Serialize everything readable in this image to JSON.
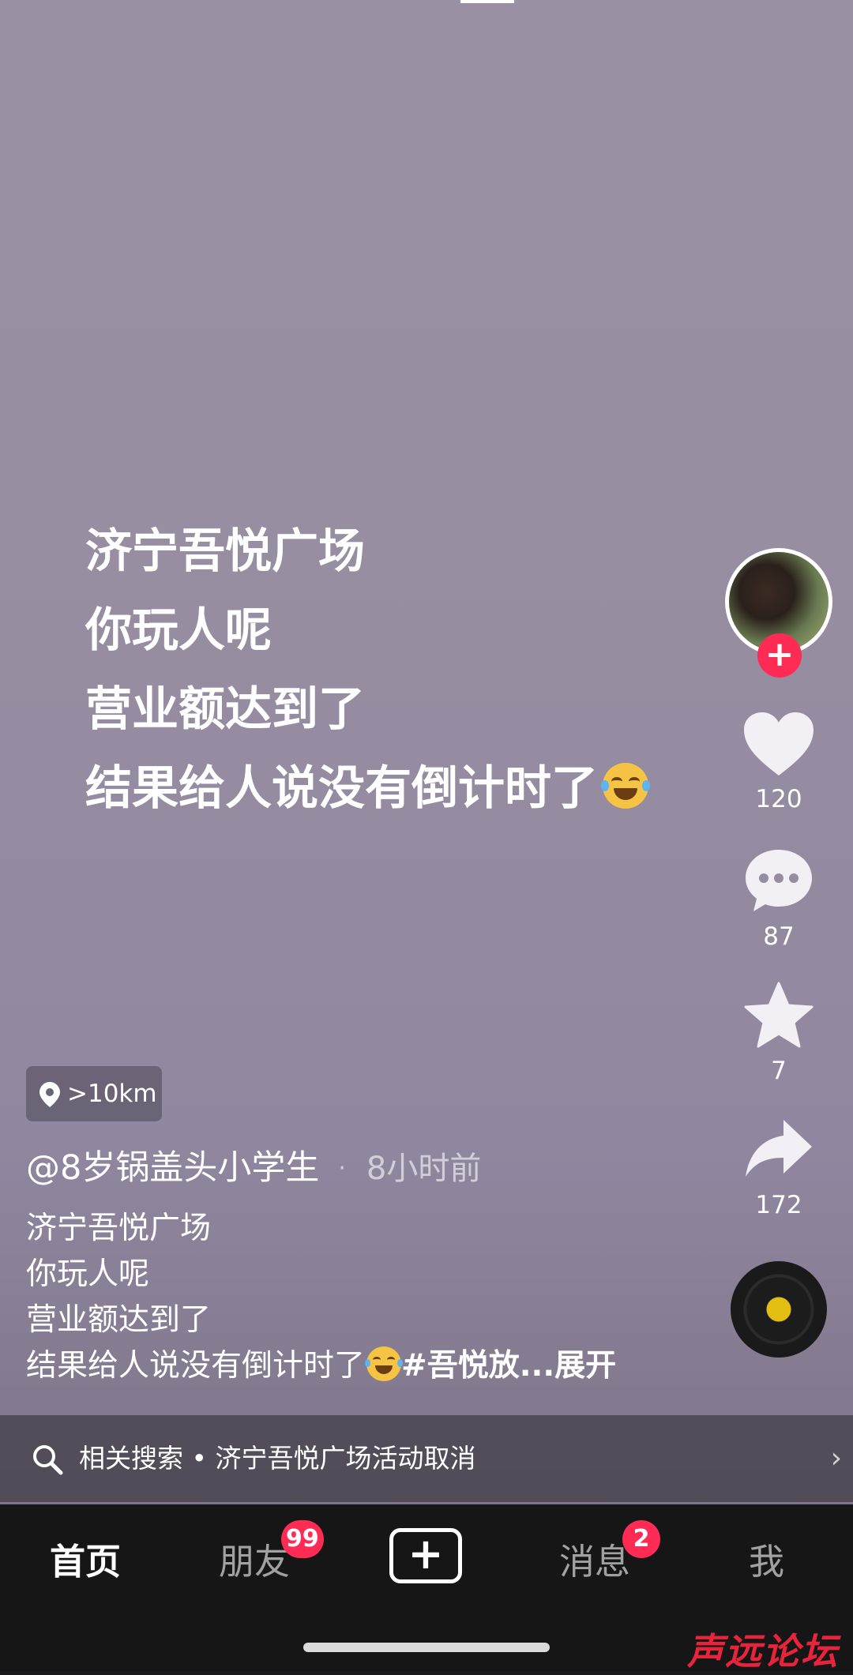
{
  "video": {
    "overlay_lines": [
      "济宁吾悦广场",
      "你玩人呢",
      "营业额达到了",
      "结果给人说没有倒计时了"
    ],
    "overlay_emoji": "laughing-with-tears-emoji"
  },
  "sidebar": {
    "follow_label": "+",
    "like_count": "120",
    "comment_count": "87",
    "favorite_count": "7",
    "share_count": "172"
  },
  "post": {
    "location": ">10km",
    "author": "@8岁锅盖头小学生",
    "separator": "·",
    "time": "8小时前",
    "desc_lines": [
      "济宁吾悦广场",
      "你玩人呢",
      "营业额达到了",
      "结果给人说没有倒计时了"
    ],
    "hashtag": "#吾悦放...",
    "expand_label": "展开"
  },
  "related_search": {
    "text": "相关搜索 • 济宁吾悦广场活动取消",
    "chevron": "›"
  },
  "nav": {
    "home": "首页",
    "friends": "朋友",
    "friends_badge": "99",
    "create": "+",
    "messages": "消息",
    "messages_badge": "2",
    "me": "我"
  },
  "watermark": "声远论坛",
  "colors": {
    "accent": "#fe2c55",
    "video_bg": "#978da1",
    "nav_bg": "#161616",
    "watermark": "#e8233c"
  }
}
